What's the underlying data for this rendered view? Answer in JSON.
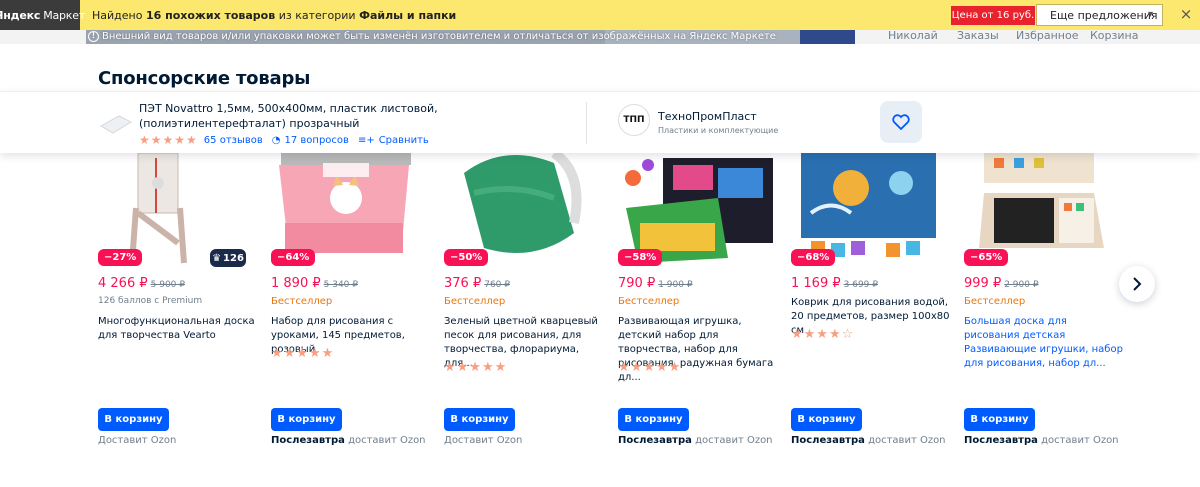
{
  "ym_bar": {
    "logo_bold": "Яндекс",
    "logo_rest": "Маркет",
    "found_prefix": "Найдено",
    "found_count": "16 похожих товаров",
    "found_mid": "из категории",
    "found_category": "Файлы и папки",
    "price_button": "Цена от 16 руб.",
    "more_button": "Еще предложения",
    "close": "×"
  },
  "warning": "Внешний вид товаров и/или упаковки может быть изменён изготовителем и отличаться от изображённых на Яндекс Маркете",
  "header_nav": [
    "Николай",
    "Заказы",
    "Избранное",
    "Корзина"
  ],
  "section_title": "Спонсорские товары",
  "sponsored": {
    "title": "ПЭТ Novattro 1,5мм, 500х400мм, пластик листовой, (полиэтилентерефталат) прозрачный",
    "stars": "★★★★★",
    "reviews": "65 отзывов",
    "questions": "17 вопросов",
    "compare": "Сравнить",
    "seller_logo": "ТПП",
    "seller_name": "ТехноПромПласт",
    "seller_sub": "Пластики и комплектующие"
  },
  "products": [
    {
      "discount": "−27%",
      "crown_count": "126",
      "price": "4 266 ₽",
      "old_price": "5 900 ₽",
      "premium": "126 баллов с Premium",
      "badge": "",
      "name": "Многофункциональная доска для творчества Vearto",
      "rating": "",
      "cart": "В корзину",
      "delivery_bold": "",
      "delivery": "Доставит Ozon"
    },
    {
      "discount": "−64%",
      "crown_count": "",
      "price": "1 890 ₽",
      "old_price": "5 340 ₽",
      "premium": "",
      "badge": "Бестселлер",
      "name": "Набор для рисования с уроками, 145 предметов, розовый",
      "rating": "★★★★★",
      "cart": "В корзину",
      "delivery_bold": "Послезавтра",
      "delivery": "доставит Ozon"
    },
    {
      "discount": "−50%",
      "crown_count": "",
      "price": "376 ₽",
      "old_price": "760 ₽",
      "premium": "",
      "badge": "Бестселлер",
      "name": "Зеленый цветной кварцевый песок для рисования, для творчества, флорариума, для...",
      "rating": "★★★★★",
      "cart": "В корзину",
      "delivery_bold": "",
      "delivery": "Доставит Ozon"
    },
    {
      "discount": "−58%",
      "crown_count": "",
      "price": "790 ₽",
      "old_price": "1 900 ₽",
      "premium": "",
      "badge": "Бестселлер",
      "name": "Развивающая игрушка, детский набор для творчества, набор для рисования, радужная бумага дл...",
      "rating": "★★★★★",
      "cart": "В корзину",
      "delivery_bold": "Послезавтра",
      "delivery": "доставит Ozon"
    },
    {
      "discount": "−68%",
      "crown_count": "",
      "price": "1 169 ₽",
      "old_price": "3 699 ₽",
      "premium": "",
      "badge": "",
      "name": "Коврик для рисования водой, 20 предметов, размер 100х80 см",
      "rating": "★★★★☆",
      "cart": "В корзину",
      "delivery_bold": "Послезавтра",
      "delivery": "доставит Ozon"
    },
    {
      "discount": "−65%",
      "crown_count": "",
      "price": "999 ₽",
      "old_price": "2 900 ₽",
      "premium": "",
      "badge": "Бестселлер",
      "name": "Большая доска для рисования детская Развивающие игрушки, набор для рисования, набор дл...",
      "rating": "",
      "cart": "В корзину",
      "delivery_bold": "Послезавтра",
      "delivery": "доставит Ozon"
    }
  ],
  "colors": {
    "accent": "#005bff",
    "discount": "#f91155",
    "bestseller": "#e8770e",
    "yandex_bar": "#fce86e"
  }
}
